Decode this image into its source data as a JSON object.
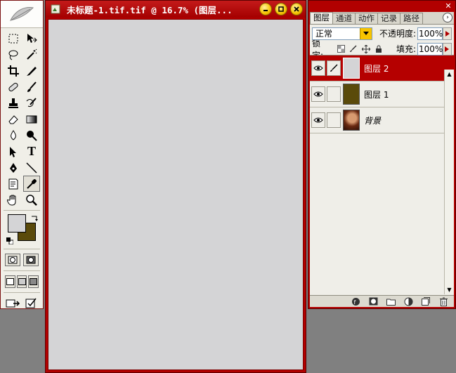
{
  "document": {
    "title": "未标题-1.tif.tif @ 16.7% (图层...",
    "canvas_color": "#d4d4d6"
  },
  "toolbox": {
    "tools": [
      "marquee-icon",
      "move-icon",
      "lasso-icon",
      "magic-wand-icon",
      "crop-icon",
      "slice-icon",
      "healing-brush-icon",
      "brush-icon",
      "clone-stamp-icon",
      "history-brush-icon",
      "eraser-icon",
      "gradient-icon",
      "blur-icon",
      "dodge-icon",
      "path-select-icon",
      "type-icon",
      "pen-icon",
      "line-icon",
      "notes-icon",
      "eyedropper-icon",
      "hand-icon",
      "zoom-icon"
    ],
    "type_tool_glyph": "T",
    "foreground_color": "#d4d4d6",
    "background_color": "#5a4a0a"
  },
  "layers_panel": {
    "tabs": [
      "图层",
      "通道",
      "动作",
      "记录",
      "路径"
    ],
    "active_tab": "图层",
    "blend_mode": "正常",
    "opacity_label": "不透明度:",
    "opacity_value": "100%",
    "lock_label": "锁定:",
    "fill_label": "填充:",
    "fill_value": "100%",
    "layers": [
      {
        "name": "图层 2",
        "thumb_color": "#d4d4d6",
        "selected": true
      },
      {
        "name": "图层 1",
        "thumb_color": "#5a4a0a",
        "selected": false
      },
      {
        "name": "背景",
        "thumb_color": "#8a4a2a",
        "selected": false,
        "locked": true
      }
    ],
    "selected_color": "#b50000"
  },
  "colors": {
    "window_frame": "#b20000",
    "workspace": "#808080"
  }
}
